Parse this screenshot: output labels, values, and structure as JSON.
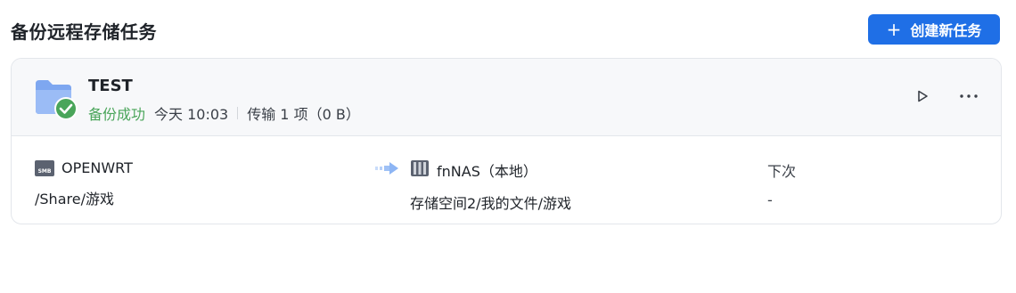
{
  "header": {
    "title": "备份远程存储任务",
    "create_button_label": "创建新任务",
    "create_button_icon": "plus-icon"
  },
  "task": {
    "name": "TEST",
    "status": "备份成功",
    "status_color": "#4aa55a",
    "time": "今天 10:03",
    "transfer": "传输 1 项（0 B）",
    "icons": {
      "folder": "folder-check-icon",
      "play": "play-icon",
      "more": "more-horizontal-icon"
    },
    "source": {
      "icon": "smb-server-icon",
      "icon_text": "SMB",
      "name": "OPENWRT",
      "path": "/Share/游戏"
    },
    "arrow_icon": "transfer-arrow-icon",
    "destination": {
      "icon": "nas-icon",
      "name": "fnNAS（本地）",
      "path": "存储空间2/我的文件/游戏"
    },
    "next": {
      "label": "下次",
      "value": "-"
    }
  },
  "colors": {
    "accent": "#1f6fe6",
    "success": "#4aa55a",
    "card_header_bg": "#f7f8fa",
    "border": "#e3e6eb"
  }
}
